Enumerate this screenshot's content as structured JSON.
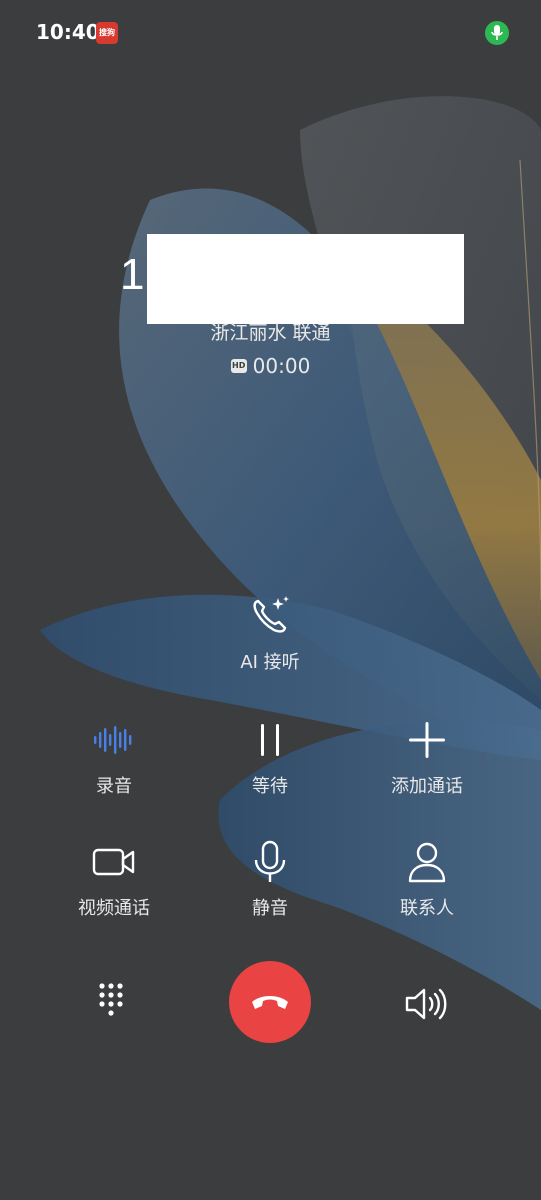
{
  "status_bar": {
    "time": "10:40",
    "app_icon_label": "搜狗",
    "mic_indicator": "mic-icon",
    "mic_color": "#2db854"
  },
  "call": {
    "number_prefix": "1",
    "location": "浙江丽水 联通",
    "hd_label": "HD",
    "duration": "00:00"
  },
  "ai_answer": {
    "label": "AI 接听",
    "icon": "ai-phone-icon"
  },
  "controls_row1": [
    {
      "label": "录音",
      "icon": "record-icon",
      "accent": "#4a7fe6"
    },
    {
      "label": "等待",
      "icon": "pause-icon"
    },
    {
      "label": "添加通话",
      "icon": "plus-icon"
    }
  ],
  "controls_row2": [
    {
      "label": "视频通话",
      "icon": "video-icon"
    },
    {
      "label": "静音",
      "icon": "mute-mic-icon"
    },
    {
      "label": "联系人",
      "icon": "contact-icon"
    }
  ],
  "bottom_bar": {
    "dialpad_icon": "dialpad-icon",
    "end_call_icon": "hangup-icon",
    "end_call_color": "#e94343",
    "speaker_icon": "speaker-icon"
  }
}
